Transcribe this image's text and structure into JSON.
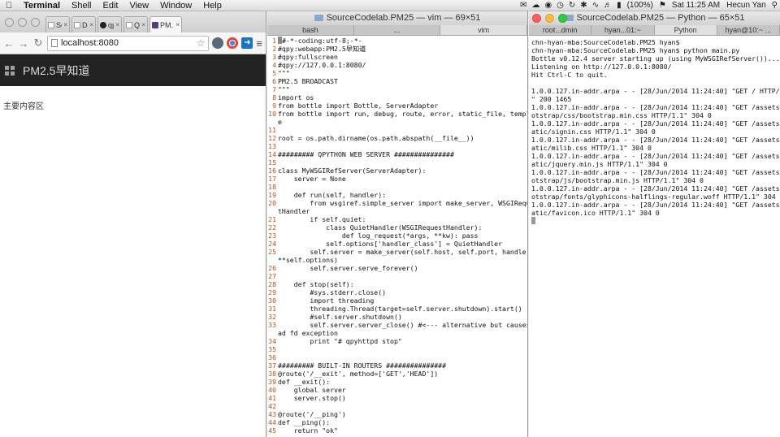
{
  "menubar": {
    "items": [
      "Terminal",
      "Shell",
      "Edit",
      "View",
      "Window",
      "Help"
    ],
    "battery": "(100%)",
    "clock": "Sat 11:25 AM",
    "user": "Hecun Yan"
  },
  "chrome": {
    "tabs": [
      {
        "label": "Sel",
        "icon": "page-icon"
      },
      {
        "label": "Dev",
        "icon": "page-icon"
      },
      {
        "label": "qpy",
        "icon": "github-icon"
      },
      {
        "label": "QP",
        "icon": "page-icon"
      },
      {
        "label": "PM.",
        "icon": "bootstrap-icon",
        "active": true
      }
    ],
    "url": "localhost:8080",
    "brand": "PM2.5早知道",
    "body_text": "主要内容区"
  },
  "vim": {
    "title": "SourceCodelab.PM25 — vim — 69×51",
    "tabs": [
      "bash",
      "...",
      "vim"
    ],
    "lines": [
      {
        "n": "1",
        "t": "#-*-coding:utf-8;-*-",
        "cursor": true
      },
      {
        "n": "2",
        "t": "#qpy:webapp:PM2.5早知道"
      },
      {
        "n": "3",
        "t": "#qpy:fullscreen"
      },
      {
        "n": "4",
        "t": "#qpy://127.0.0.1:8080/"
      },
      {
        "n": "5",
        "t": "\"\"\""
      },
      {
        "n": "6",
        "t": "PM2.5 BROADCAST"
      },
      {
        "n": "7",
        "t": "\"\"\""
      },
      {
        "n": "8",
        "t": "import os"
      },
      {
        "n": "9",
        "t": "from bottle import Bottle, ServerAdapter"
      },
      {
        "n": "10",
        "t": "from bottle import run, debug, route, error, static_file, templat"
      },
      {
        "n": "",
        "t": "e"
      },
      {
        "n": "11",
        "t": ""
      },
      {
        "n": "12",
        "t": "root = os.path.dirname(os.path.abspath(__file__))"
      },
      {
        "n": "13",
        "t": ""
      },
      {
        "n": "14",
        "t": "######### QPYTHON WEB SERVER ###############"
      },
      {
        "n": "15",
        "t": ""
      },
      {
        "n": "16",
        "t": "class MyWSGIRefServer(ServerAdapter):"
      },
      {
        "n": "17",
        "t": "    server = None"
      },
      {
        "n": "18",
        "t": ""
      },
      {
        "n": "19",
        "t": "    def run(self, handler):"
      },
      {
        "n": "20",
        "t": "        from wsgiref.simple_server import make_server, WSGIReques"
      },
      {
        "n": "",
        "t": "tHandler"
      },
      {
        "n": "21",
        "t": "        if self.quiet:"
      },
      {
        "n": "22",
        "t": "            class QuietHandler(WSGIRequestHandler):"
      },
      {
        "n": "23",
        "t": "                def log_request(*args, **kw): pass"
      },
      {
        "n": "24",
        "t": "            self.options['handler_class'] = QuietHandler"
      },
      {
        "n": "25",
        "t": "        self.server = make_server(self.host, self.port, handler,"
      },
      {
        "n": "",
        "t": "**self.options)"
      },
      {
        "n": "26",
        "t": "        self.server.serve_forever()"
      },
      {
        "n": "27",
        "t": ""
      },
      {
        "n": "28",
        "t": "    def stop(self):"
      },
      {
        "n": "29",
        "t": "        #sys.stderr.close()"
      },
      {
        "n": "30",
        "t": "        import threading"
      },
      {
        "n": "31",
        "t": "        threading.Thread(target=self.server.shutdown).start()"
      },
      {
        "n": "32",
        "t": "        #self.server.shutdown()"
      },
      {
        "n": "33",
        "t": "        self.server.server_close() #<--- alternative but causes b"
      },
      {
        "n": "",
        "t": "ad fd exception"
      },
      {
        "n": "34",
        "t": "        print \"# qpyhttpd stop\""
      },
      {
        "n": "35",
        "t": ""
      },
      {
        "n": "36",
        "t": ""
      },
      {
        "n": "37",
        "t": "######### BUILT-IN ROUTERS ###############"
      },
      {
        "n": "38",
        "t": "@route('/__exit', method=['GET','HEAD'])"
      },
      {
        "n": "39",
        "t": "def __exit():"
      },
      {
        "n": "40",
        "t": "    global server"
      },
      {
        "n": "41",
        "t": "    server.stop()"
      },
      {
        "n": "42",
        "t": ""
      },
      {
        "n": "43",
        "t": "@route('/__ping')"
      },
      {
        "n": "44",
        "t": "def __ping():"
      },
      {
        "n": "45",
        "t": "    return \"ok\""
      }
    ]
  },
  "python": {
    "title": "SourceCodelab.PM25 — Python — 65×51",
    "tabs": [
      "root...dmin",
      "hyan...01:~",
      "Python",
      "hyan@10:~ ..."
    ],
    "lines": [
      "chn-hyan-mba:SourceCodelab.PM25 hyan$",
      "chn-hyan-mba:SourceCodelab.PM25 hyan$ python main.py",
      "Bottle v0.12.4 server starting up (using MyWSGIRefServer())...",
      "Listening on http://127.0.0.1:8080/",
      "Hit Ctrl-C to quit.",
      "",
      "1.0.0.127.in-addr.arpa - - [28/Jun/2014 11:24:40] \"GET / HTTP/1.1",
      "\" 200 1465",
      "1.0.0.127.in-addr.arpa - - [28/Jun/2014 11:24:40] \"GET /assets/bo",
      "otstrap/css/bootstrap.min.css HTTP/1.1\" 304 0",
      "1.0.0.127.in-addr.arpa - - [28/Jun/2014 11:24:40] \"GET /assets/st",
      "atic/signin.css HTTP/1.1\" 304 0",
      "1.0.0.127.in-addr.arpa - - [28/Jun/2014 11:24:40] \"GET /assets/st",
      "atic/milib.css HTTP/1.1\" 304 0",
      "1.0.0.127.in-addr.arpa - - [28/Jun/2014 11:24:40] \"GET /assets/st",
      "atic/jquery.min.js HTTP/1.1\" 304 0",
      "1.0.0.127.in-addr.arpa - - [28/Jun/2014 11:24:40] \"GET /assets/bo",
      "otstrap/js/bootstrap.min.js HTTP/1.1\" 304 0",
      "1.0.0.127.in-addr.arpa - - [28/Jun/2014 11:24:40] \"GET /assets/bo",
      "otstrap/fonts/glyphicons-halflings-regular.woff HTTP/1.1\" 304 0",
      "1.0.0.127.in-addr.arpa - - [28/Jun/2014 11:24:40] \"GET /assets/st",
      "atic/favicon.ico HTTP/1.1\" 304 0"
    ]
  }
}
